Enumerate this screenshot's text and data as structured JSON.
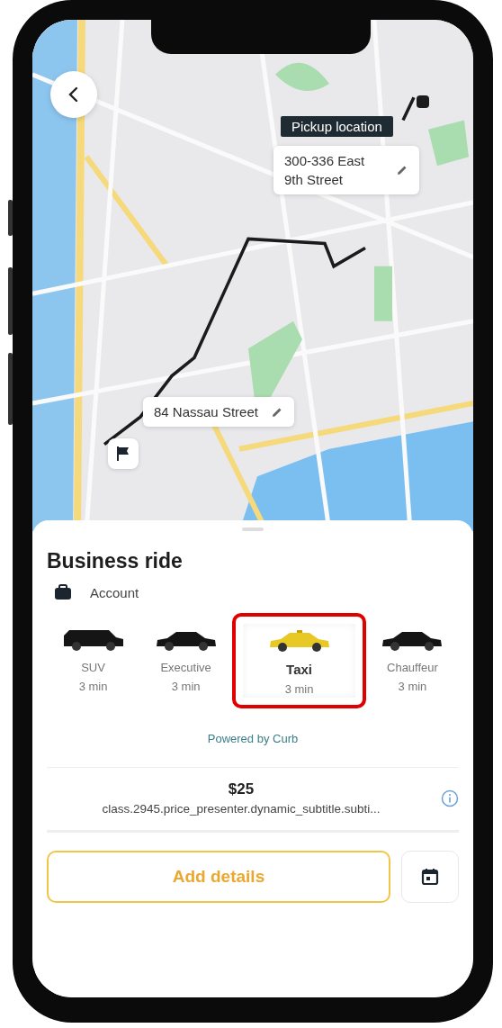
{
  "pickup": {
    "tooltip": "Pickup location",
    "address": "300-336 East 9th Street"
  },
  "dropoff": {
    "address": "84 Nassau Street"
  },
  "sheet": {
    "title": "Business ride",
    "account": "Account",
    "vehicles": [
      {
        "name": "SUV",
        "eta": "3 min",
        "kind": "suv",
        "selected": false
      },
      {
        "name": "Executive",
        "eta": "3 min",
        "kind": "sedan",
        "selected": false
      },
      {
        "name": "Taxi",
        "eta": "3 min",
        "kind": "taxi",
        "selected": true
      },
      {
        "name": "Chauffeur",
        "eta": "3 min",
        "kind": "sedan",
        "selected": false
      }
    ],
    "powered_by": "Powered by Curb",
    "price": "$25",
    "price_subtitle": "class.2945.price_presenter.dynamic_subtitle.subti...",
    "primary_button": "Add details"
  }
}
